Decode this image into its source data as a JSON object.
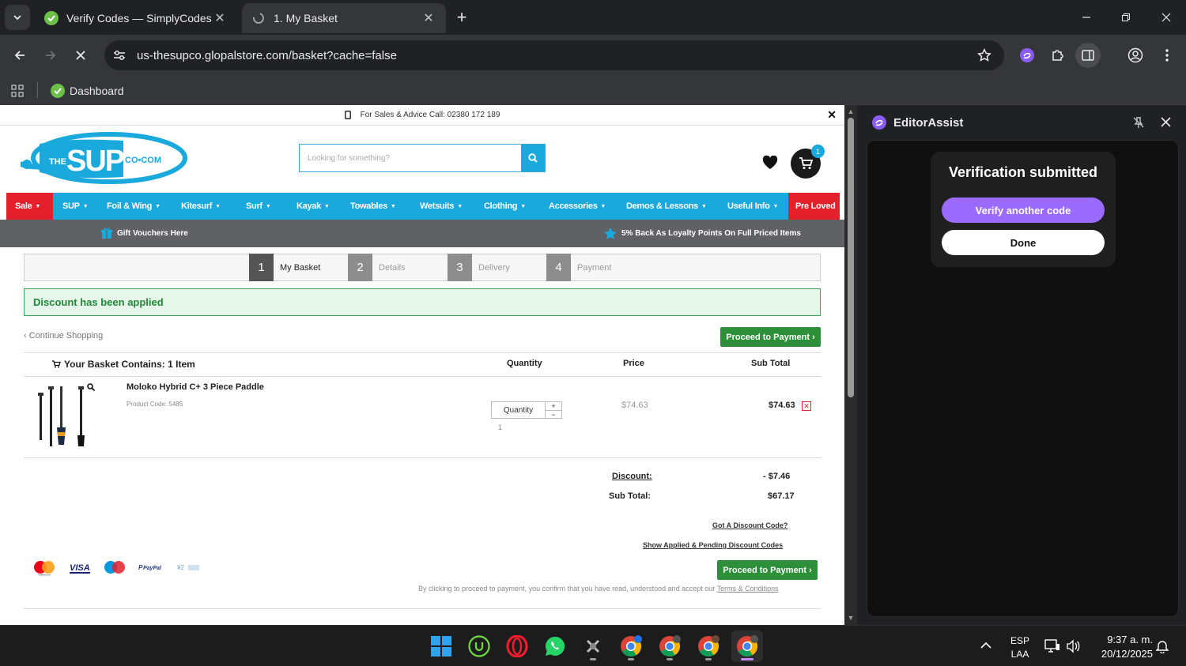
{
  "browser": {
    "tabs": [
      {
        "title": "Verify Codes — SimplyCodes",
        "active": false
      },
      {
        "title": "1. My Basket",
        "active": true
      }
    ],
    "url": "us-thesupco.glopalstore.com/basket?cache=false",
    "bookmarks": [
      {
        "label": "Dashboard"
      }
    ]
  },
  "site": {
    "topbar_text": "For Sales & Advice Call: 02380 172 189",
    "logo_text": "THE SUP CO.COM",
    "search_placeholder": "Looking for something?",
    "cart_count": "1",
    "nav": [
      {
        "label": "Sale",
        "highlight": "red"
      },
      {
        "label": "SUP"
      },
      {
        "label": "Foil & Wing"
      },
      {
        "label": "Kitesurf"
      },
      {
        "label": "Surf"
      },
      {
        "label": "Kayak"
      },
      {
        "label": "Towables"
      },
      {
        "label": "Wetsuits"
      },
      {
        "label": "Clothing"
      },
      {
        "label": "Accessories"
      },
      {
        "label": "Demos & Lessons"
      },
      {
        "label": "Useful Info"
      },
      {
        "label": "Pre Loved",
        "highlight": "red"
      }
    ],
    "promos": [
      "Gift Vouchers Here",
      "5% Back As Loyalty Points On Full Priced Items"
    ]
  },
  "checkout": {
    "steps": [
      {
        "num": "1",
        "label": "My Basket",
        "active": true
      },
      {
        "num": "2",
        "label": "Details",
        "active": false
      },
      {
        "num": "3",
        "label": "Delivery",
        "active": false
      },
      {
        "num": "4",
        "label": "Payment",
        "active": false
      }
    ],
    "discount_message": "Discount has been applied",
    "continue_shopping": "‹ Continue Shopping",
    "proceed_label": "Proceed to Payment ›",
    "table_headers": {
      "contents": "Your Basket Contains: 1 Item",
      "quantity": "Quantity",
      "price": "Price",
      "subtotal": "Sub Total"
    },
    "item": {
      "name": "Moloko Hybrid C+ 3 Piece Paddle",
      "code": "Product Code: 5485",
      "qty_label": "Quantity",
      "qty_value": "1",
      "price": "$74.63",
      "subtotal": "$74.63"
    },
    "totals": {
      "discount_label": "Discount:",
      "discount_value": "- $7.46",
      "subtotal_label": "Sub Total:",
      "subtotal_value": "$67.17"
    },
    "links": {
      "discount_code": "Got A Discount Code?",
      "show_codes": "Show Applied & Pending Discount Codes"
    },
    "payment_icons": [
      "mastercard",
      "visa",
      "maestro",
      "paypal",
      "klarna"
    ],
    "terms_prefix": "By clicking to proceed to payment, you confirm that you have read, understood and accept our",
    "terms_link": "Terms & Conditions"
  },
  "sidepanel": {
    "title": "EditorAssist",
    "card_title": "Verification submitted",
    "verify_label": "Verify another code",
    "done_label": "Done"
  },
  "taskbar": {
    "lang1": "ESP",
    "lang2": "LAA",
    "time": "9:37 a. m.",
    "date": "20/12/2025"
  },
  "colors": {
    "brand_blue": "#1aa9dc",
    "sale_red": "#e3202b",
    "green_button": "#2d8f3a",
    "assist_purple": "#9b6bff"
  }
}
